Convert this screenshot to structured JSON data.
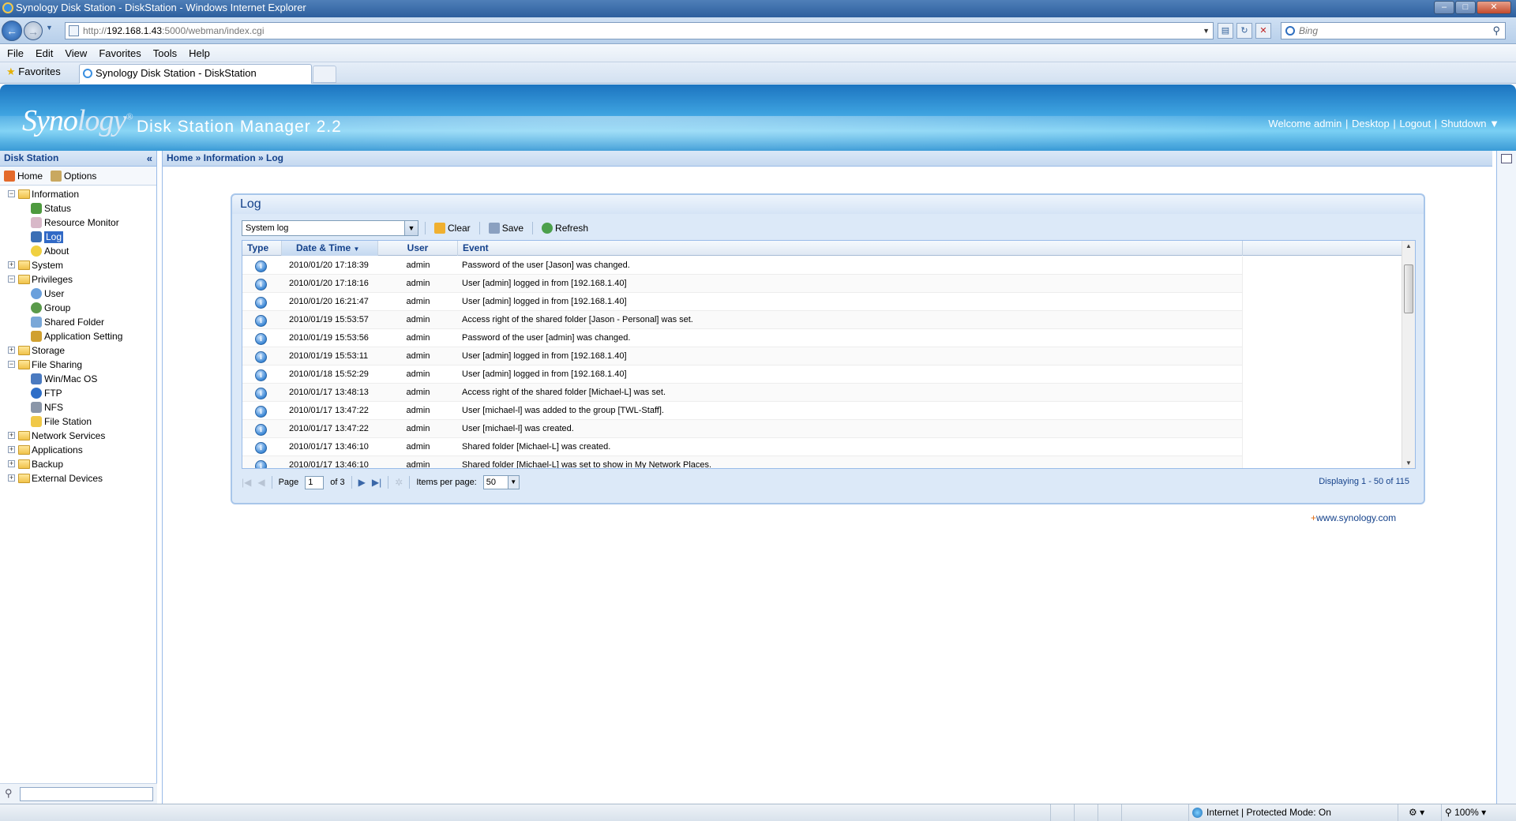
{
  "browser": {
    "title": "Synology Disk Station - DiskStation - Windows Internet Explorer",
    "address_prefix": "http://",
    "address_host": "192.168.1.43",
    "address_rest": ":5000/webman/index.cgi",
    "search_placeholder": "Bing",
    "menu": [
      "File",
      "Edit",
      "View",
      "Favorites",
      "Tools",
      "Help"
    ],
    "favorites_label": "Favorites",
    "tab_title": "Synology Disk Station - DiskStation",
    "status_zone": "Internet | Protected Mode: On",
    "zoom": "100%"
  },
  "header": {
    "logo_a": "Syno",
    "logo_b": "logy",
    "product": "Disk Station Manager 2.2",
    "welcome": "Welcome admin",
    "desktop": "Desktop",
    "logout": "Logout",
    "shutdown": "Shutdown ▼"
  },
  "sidebar": {
    "title": "Disk Station",
    "home": "Home",
    "options": "Options",
    "tree": [
      {
        "label": "Information",
        "expanded": true,
        "children": [
          "Status",
          "Resource Monitor",
          "Log",
          "About"
        ]
      },
      {
        "label": "System",
        "expanded": false
      },
      {
        "label": "Privileges",
        "expanded": true,
        "children": [
          "User",
          "Group",
          "Shared Folder",
          "Application Setting"
        ]
      },
      {
        "label": "Storage",
        "expanded": false
      },
      {
        "label": "File Sharing",
        "expanded": true,
        "children": [
          "Win/Mac OS",
          "FTP",
          "NFS",
          "File Station"
        ]
      },
      {
        "label": "Network Services",
        "expanded": false
      },
      {
        "label": "Applications",
        "expanded": false
      },
      {
        "label": "Backup",
        "expanded": false
      },
      {
        "label": "External Devices",
        "expanded": false
      }
    ],
    "selected": "Log"
  },
  "breadcrumb": "Home » Information » Log",
  "log": {
    "title": "Log",
    "select_value": "System log",
    "clear": "Clear",
    "save": "Save",
    "refresh": "Refresh",
    "columns": [
      "Type",
      "Date & Time",
      "User",
      "Event"
    ],
    "rows": [
      {
        "date": "2010/01/20 17:18:39",
        "user": "admin",
        "event": "Password of the user [Jason] was changed."
      },
      {
        "date": "2010/01/20 17:18:16",
        "user": "admin",
        "event": "User [admin] logged in from [192.168.1.40]"
      },
      {
        "date": "2010/01/20 16:21:47",
        "user": "admin",
        "event": "User [admin] logged in from [192.168.1.40]"
      },
      {
        "date": "2010/01/19 15:53:57",
        "user": "admin",
        "event": "Access right of the shared folder [Jason - Personal] was set."
      },
      {
        "date": "2010/01/19 15:53:56",
        "user": "admin",
        "event": "Password of the user [admin] was changed."
      },
      {
        "date": "2010/01/19 15:53:11",
        "user": "admin",
        "event": "User [admin] logged in from [192.168.1.40]"
      },
      {
        "date": "2010/01/18 15:52:29",
        "user": "admin",
        "event": "User [admin] logged in from [192.168.1.40]"
      },
      {
        "date": "2010/01/17 13:48:13",
        "user": "admin",
        "event": "Access right of the shared folder [Michael-L] was set."
      },
      {
        "date": "2010/01/17 13:47:22",
        "user": "admin",
        "event": "User [michael-l] was added to the group [TWL-Staff]."
      },
      {
        "date": "2010/01/17 13:47:22",
        "user": "admin",
        "event": "User [michael-l] was created."
      },
      {
        "date": "2010/01/17 13:46:10",
        "user": "admin",
        "event": "Shared folder [Michael-L] was created."
      },
      {
        "date": "2010/01/17 13:46:10",
        "user": "admin",
        "event": "Shared folder [Michael-L] was set to show in My Network Places."
      }
    ],
    "page_label": "Page",
    "page_value": "1",
    "of_label": "of 3",
    "ipp_label": "Items per page:",
    "ipp_value": "50",
    "displaying": "Displaying 1 - 50 of 115"
  },
  "footer_link": "www.synology.com"
}
